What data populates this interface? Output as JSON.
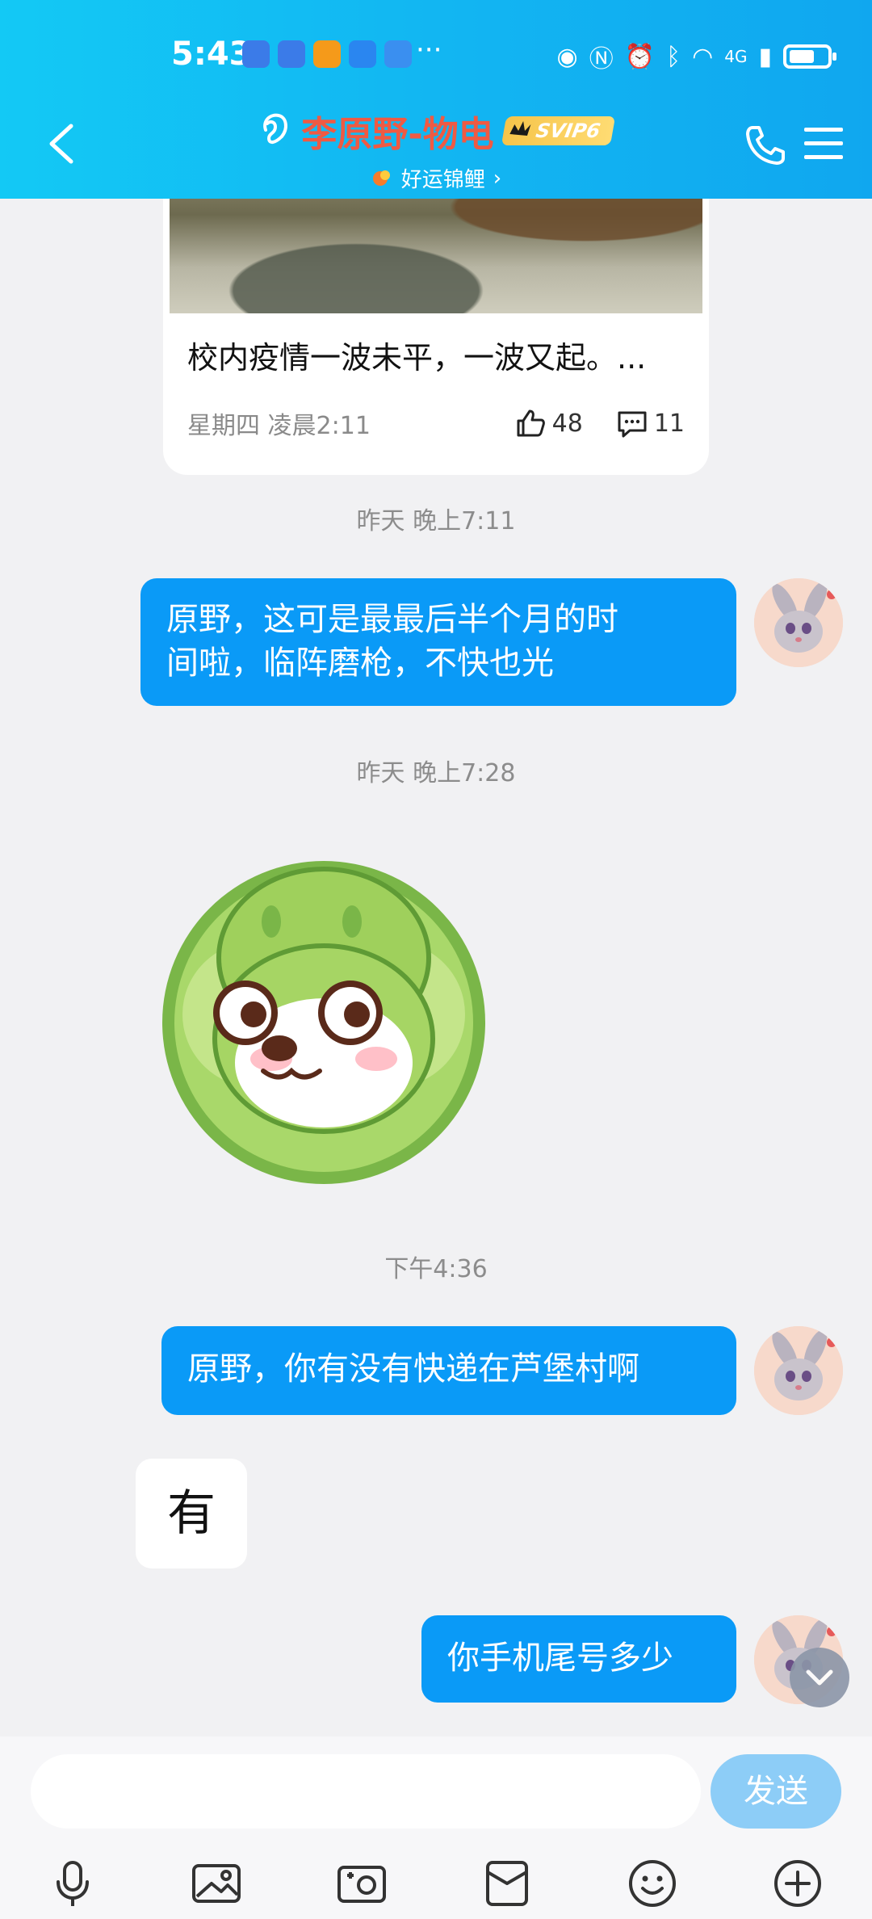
{
  "status_bar": {
    "time": "5:43",
    "more": "···",
    "network": "4G"
  },
  "chat_header": {
    "contact_name": "李原野-物电",
    "vip_badge": "SVIP6",
    "subtitle": "好运锦鲤",
    "subtitle_chevron": "›"
  },
  "shared_post": {
    "title": "校内疫情一波未平，一波又起。...",
    "date": "星期四 凌晨2:11",
    "likes": "48",
    "comments": "11"
  },
  "messages": [
    {
      "timestamp": "昨天 晚上7:11"
    },
    {
      "text": "原野，这可是最最后半个月的时间啦，临阵磨枪，不快也光",
      "line1": "原野，这可是最最后半个月的时",
      "line2": "间啦，临阵磨枪，不快也光"
    },
    {
      "timestamp": "昨天 晚上7:28"
    },
    {
      "timestamp": "下午4:36"
    },
    {
      "text": "原野，你有没有快递在芦堡村啊"
    },
    {
      "text": "有"
    },
    {
      "text": "你手机尾号多少"
    }
  ],
  "input": {
    "placeholder": "",
    "send_label": "发送"
  },
  "toolbar_icons": [
    "mic-icon",
    "image-icon",
    "camera-icon",
    "red-packet-icon",
    "emoji-icon",
    "plus-icon"
  ],
  "colors": {
    "header": "#12b6f2",
    "bubble_out": "#0a9af7",
    "name": "#ef5a43",
    "send_disabled": "#8dcdf7"
  }
}
